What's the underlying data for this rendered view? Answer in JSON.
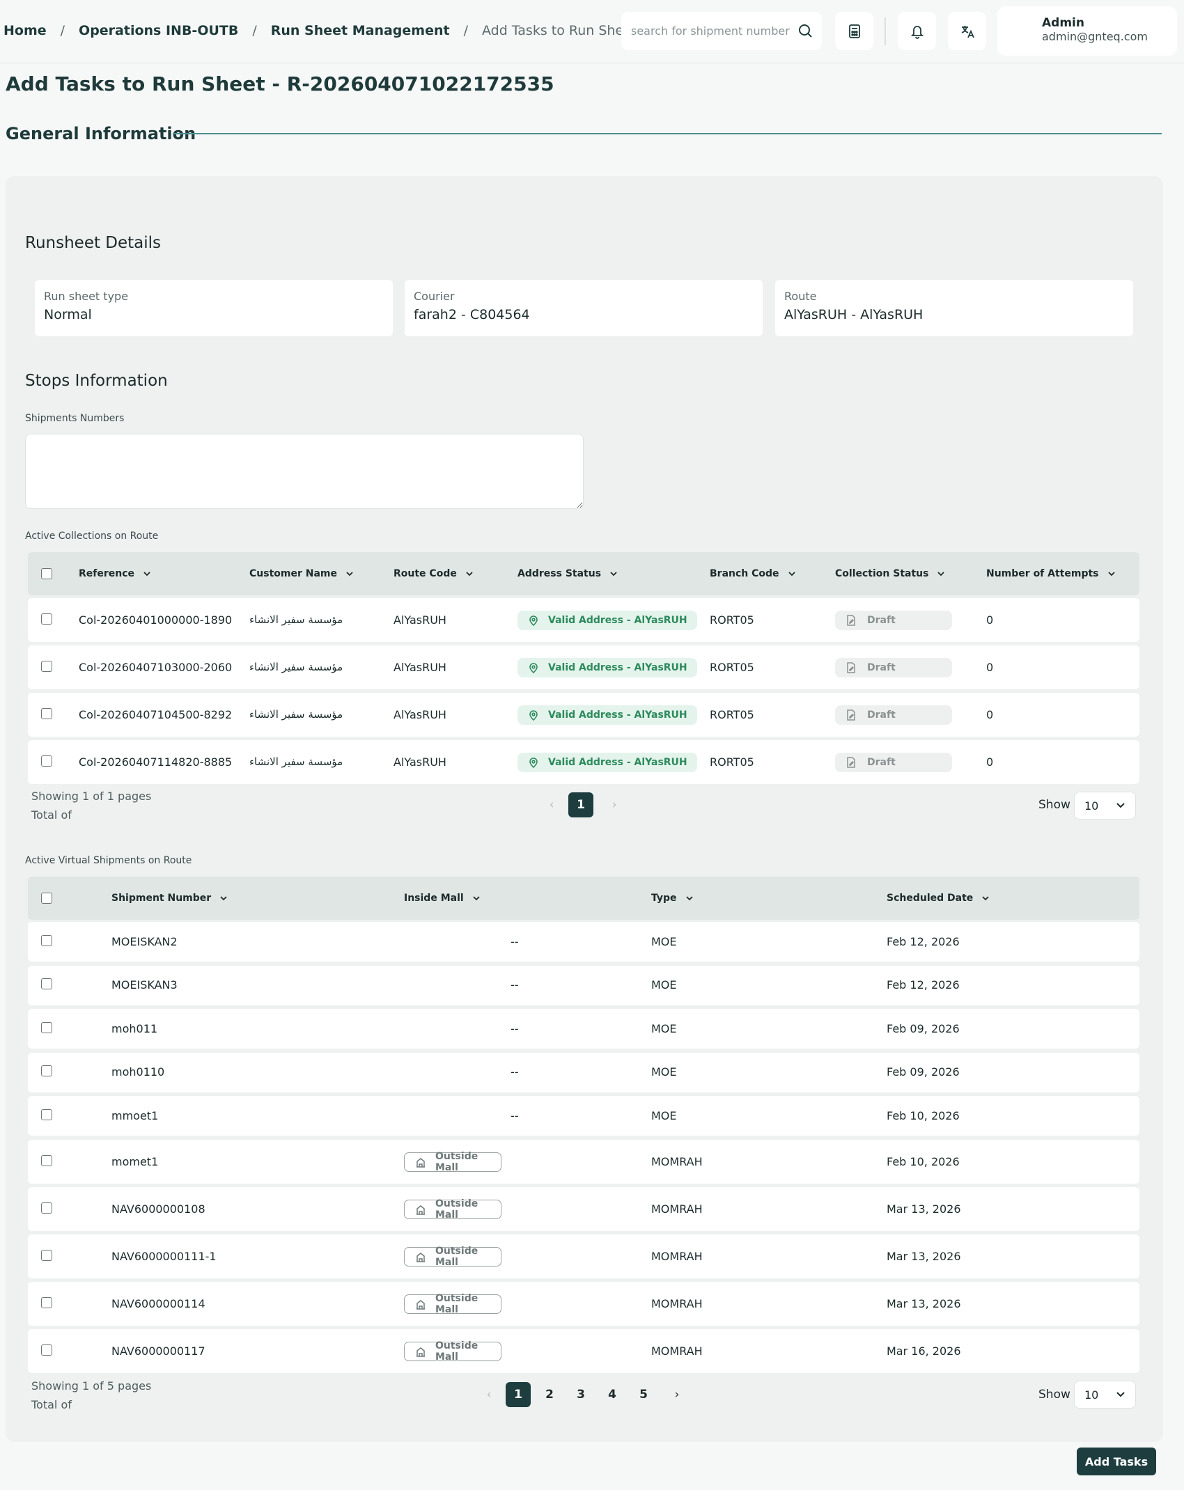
{
  "breadcrumb": [
    {
      "label": "Home"
    },
    {
      "label": "Operations INB-OUTB"
    },
    {
      "label": "Run Sheet Management"
    },
    {
      "label": "Add Tasks to Run Sheet"
    }
  ],
  "header": {
    "search_placeholder": "search for shipment number",
    "user_name": "Admin",
    "user_email": "admin@gnteq.com"
  },
  "page_title": "Add Tasks to Run Sheet - R-20260407102217253‌5",
  "general_section_title": "General Information",
  "runsheet": {
    "title": "Runsheet Details",
    "fields": [
      {
        "label": "Run sheet type",
        "value": "Normal"
      },
      {
        "label": "Courier",
        "value": "farah2 - C804564"
      },
      {
        "label": "Route",
        "value": "AlYasRUH - AlYasRUH"
      }
    ]
  },
  "stops": {
    "title": "Stops Information",
    "shipments_label": "Shipments Numbers",
    "shipments_value": ""
  },
  "collections": {
    "title": "Active Collections on Route",
    "columns": [
      "Reference",
      "Customer Name",
      "Route Code",
      "Address Status",
      "Branch Code",
      "Collection Status",
      "Number of Attempts"
    ],
    "rows": [
      {
        "reference": "Col-20260401000000-1890",
        "customer": "مؤسسة سفير الانشاء",
        "route": "AlYasRUH",
        "address_status": "Valid Address - AlYasRUH",
        "branch": "RORT05",
        "status": "Draft",
        "attempts": "0"
      },
      {
        "reference": "Col-20260407103000-2060",
        "customer": "مؤسسة سفير الانشاء",
        "route": "AlYasRUH",
        "address_status": "Valid Address - AlYasRUH",
        "branch": "RORT05",
        "status": "Draft",
        "attempts": "0"
      },
      {
        "reference": "Col-20260407104500-8292",
        "customer": "مؤسسة سفير الانشاء",
        "route": "AlYasRUH",
        "address_status": "Valid Address - AlYasRUH",
        "branch": "RORT05",
        "status": "Draft",
        "attempts": "0"
      },
      {
        "reference": "Col-20260407114820-8885",
        "customer": "مؤسسة سفير الانشاء",
        "route": "AlYasRUH",
        "address_status": "Valid Address - AlYasRUH",
        "branch": "RORT05",
        "status": "Draft",
        "attempts": "0"
      }
    ],
    "pagination": {
      "showing": "Showing 1 of 1 pages",
      "total": "Total of",
      "pages": [
        "1"
      ],
      "show_label": "Show",
      "page_size": "10"
    }
  },
  "virtual": {
    "title": "Active Virtual Shipments on Route",
    "columns": [
      "Shipment Number",
      "Inside Mall",
      "Type",
      "Scheduled Date"
    ],
    "rows": [
      {
        "number": "MOEISKAN2",
        "mall": "--",
        "type": "MOE",
        "date": "Feb 12, 2026"
      },
      {
        "number": "MOEISKAN3",
        "mall": "--",
        "type": "MOE",
        "date": "Feb 12, 2026"
      },
      {
        "number": "moh011",
        "mall": "--",
        "type": "MOE",
        "date": "Feb 09, 2026"
      },
      {
        "number": "moh0110",
        "mall": "--",
        "type": "MOE",
        "date": "Feb 09, 2026"
      },
      {
        "number": "mmoet1",
        "mall": "--",
        "type": "MOE",
        "date": "Feb 10, 2026"
      },
      {
        "number": "momet1",
        "mall": "Outside Mall",
        "type": "MOMRAH",
        "date": "Feb 10, 2026"
      },
      {
        "number": "NAV6000000108",
        "mall": "Outside Mall",
        "type": "MOMRAH",
        "date": "Mar 13, 2026"
      },
      {
        "number": "NAV6000000111-1",
        "mall": "Outside Mall",
        "type": "MOMRAH",
        "date": "Mar 13, 2026"
      },
      {
        "number": "NAV6000000114",
        "mall": "Outside Mall",
        "type": "MOMRAH",
        "date": "Mar 13, 2026"
      },
      {
        "number": "NAV6000000117",
        "mall": "Outside Mall",
        "type": "MOMRAH",
        "date": "Mar 16, 2026"
      }
    ],
    "pagination": {
      "showing": "Showing 1 of 5 pages",
      "total": "Total of",
      "pages": [
        "1",
        "2",
        "3",
        "4",
        "5"
      ],
      "show_label": "Show",
      "page_size": "10"
    }
  },
  "actions": {
    "add_tasks": "Add Tasks"
  },
  "colors": {
    "primary": "#1d3d3f",
    "accent_line": "#4f8f94",
    "valid_green": "#2c8a5c"
  }
}
